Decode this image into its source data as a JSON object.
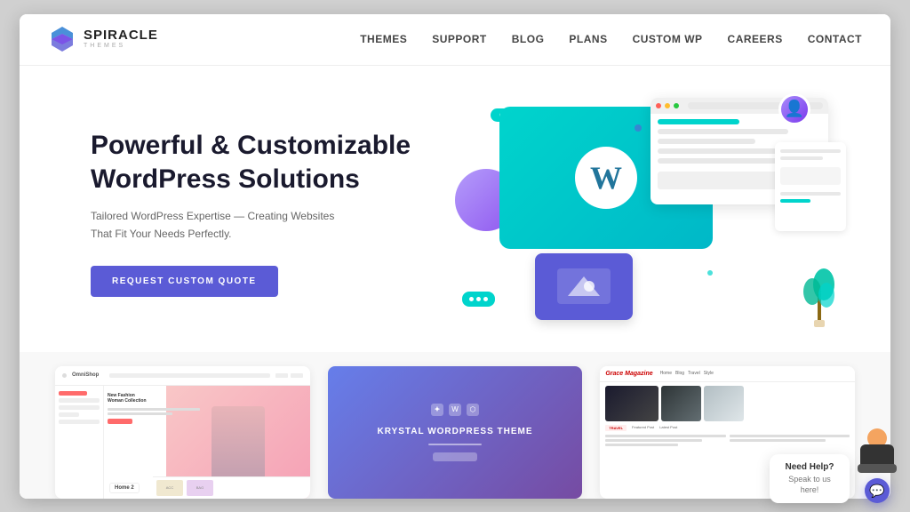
{
  "brand": {
    "name": "SPIRACLE",
    "sub": "THEMES"
  },
  "nav": {
    "items": [
      {
        "label": "THEMES",
        "id": "themes"
      },
      {
        "label": "SUPPORT",
        "id": "support"
      },
      {
        "label": "BLOG",
        "id": "blog"
      },
      {
        "label": "PLANS",
        "id": "plans"
      },
      {
        "label": "CUSTOM WP",
        "id": "custom-wp"
      },
      {
        "label": "CAREERS",
        "id": "careers"
      },
      {
        "label": "CONTACT",
        "id": "contact"
      }
    ]
  },
  "hero": {
    "title_line1": "Powerful & Customizable",
    "title_line2": "WordPress Solutions",
    "subtitle": "Tailored WordPress Expertise — Creating Websites That Fit Your Needs Perfectly.",
    "cta": "REQUEST CUSTOM QUOTE"
  },
  "themes": {
    "items": [
      {
        "name": "OmniShop",
        "label": "Home 2"
      },
      {
        "name": "Krystal",
        "title": "KRYSTAL WORDPRESS THEME"
      },
      {
        "name": "GraceMagazine",
        "logo": "Grace Magazine"
      }
    ]
  },
  "help": {
    "title": "Need Help?",
    "subtitle": "Speak to us here!"
  },
  "icons": {
    "chat": "💬",
    "wp": "W"
  }
}
